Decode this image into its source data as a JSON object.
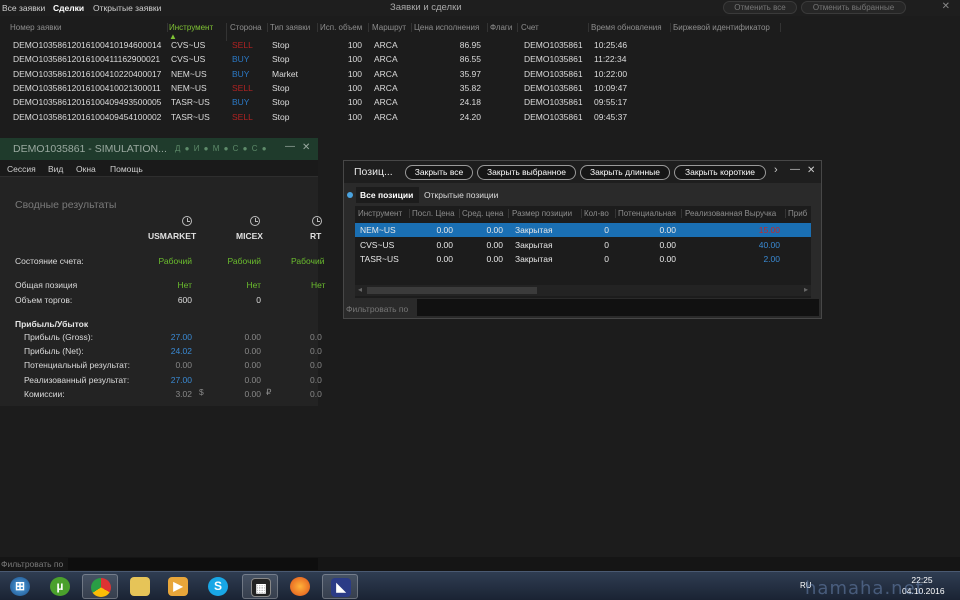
{
  "orders_window": {
    "tabs": [
      "Все заявки",
      "Сделки",
      "Открытые заявки"
    ],
    "active_tab": "Сделки",
    "title": "Заявки и сделки",
    "cancel_all": "Отменить все",
    "cancel_selected": "Отменить выбранные",
    "columns": [
      "Номер заявки",
      "Инструмент ▲",
      "Сторона",
      "Тип заявки",
      "Исп. объем",
      "Маршрут",
      "Цена исполнения",
      "Флаги",
      "Счет",
      "Время обновления",
      "Биржевой идентификатор"
    ],
    "rows": [
      {
        "id": "DEMO10358612016100410194600014",
        "instrument": "CVS~US",
        "side": "SELL",
        "type": "Stop",
        "qty": "100",
        "route": "ARCA",
        "price": "86.95",
        "account": "DEMO1035861",
        "time": "10:25:46"
      },
      {
        "id": "DEMO10358612016100411162900021",
        "instrument": "CVS~US",
        "side": "BUY",
        "type": "Stop",
        "qty": "100",
        "route": "ARCA",
        "price": "86.55",
        "account": "DEMO1035861",
        "time": "11:22:34"
      },
      {
        "id": "DEMO10358612016100410220400017",
        "instrument": "NEM~US",
        "side": "BUY",
        "type": "Market",
        "qty": "100",
        "route": "ARCA",
        "price": "35.97",
        "account": "DEMO1035861",
        "time": "10:22:00"
      },
      {
        "id": "DEMO10358612016100410021300011",
        "instrument": "NEM~US",
        "side": "SELL",
        "type": "Stop",
        "qty": "100",
        "route": "ARCA",
        "price": "35.82",
        "account": "DEMO1035861",
        "time": "10:09:47"
      },
      {
        "id": "DEMO10358612016100409493500005",
        "instrument": "TASR~US",
        "side": "BUY",
        "type": "Stop",
        "qty": "100",
        "route": "ARCA",
        "price": "24.18",
        "account": "DEMO1035861",
        "time": "09:55:17"
      },
      {
        "id": "DEMO10358612016100409454100002",
        "instrument": "TASR~US",
        "side": "SELL",
        "type": "Stop",
        "qty": "100",
        "route": "ARCA",
        "price": "24.20",
        "account": "DEMO1035861",
        "time": "09:45:37"
      }
    ]
  },
  "dashboard": {
    "title": "DEMO1035861 - SIMULATION...",
    "title_dots": "Д ● И ● М ● С ● С ●",
    "menu": [
      "Сессия",
      "Вид",
      "Окна",
      "Помощь"
    ],
    "section": "Сводные результаты",
    "markets": [
      "USMARKET",
      "MICEX",
      "RT"
    ],
    "labels": {
      "state": "Состояние счета:",
      "position": "Общая позиция",
      "volume": "Объем торгов:",
      "pnl": "Прибыль/Убыток",
      "gross": "Прибыль (Gross):",
      "net": "Прибыль (Net):",
      "potential": "Потенциальный результат:",
      "realized": "Реализованный результат:",
      "commission": "Комиссии:"
    },
    "values": {
      "state": [
        "Рабочий",
        "Рабочий",
        "Рабочий"
      ],
      "position": [
        "Нет",
        "Нет",
        "Нет"
      ],
      "volume": [
        "600",
        "0"
      ],
      "gross": [
        "27.00",
        "0.00",
        "0.0"
      ],
      "net": [
        "24.02",
        "0.00",
        "0.0"
      ],
      "potential": [
        "0.00",
        "0.00",
        "0.0"
      ],
      "realized": [
        "27.00",
        "0.00",
        "0.0"
      ],
      "commission": [
        "3.02",
        "0.00",
        "0.0"
      ]
    },
    "currency": [
      "$",
      "₽"
    ]
  },
  "positions": {
    "title": "Позиц...",
    "buttons": [
      "Закрыть все",
      "Закрыть выбранное",
      "Закрыть длинные",
      "Закрыть короткие"
    ],
    "tabs": [
      "Все позиции",
      "Открытые позиции"
    ],
    "columns": [
      "Инструмент",
      "Посл. Цена",
      "Сред. цена",
      "Размер позиции",
      "Кол-во",
      "Потенциальная",
      "Реализованная Выручка",
      "Приб"
    ],
    "rows": [
      {
        "instrument": "NEM~US",
        "last": "0.00",
        "avg": "0.00",
        "size": "Закрытая",
        "qty": "0",
        "potential": "0.00",
        "realized": "15.00"
      },
      {
        "instrument": "CVS~US",
        "last": "0.00",
        "avg": "0.00",
        "size": "Закрытая",
        "qty": "0",
        "potential": "0.00",
        "realized": "40.00"
      },
      {
        "instrument": "TASR~US",
        "last": "0.00",
        "avg": "0.00",
        "size": "Закрытая",
        "qty": "0",
        "potential": "0.00",
        "realized": "2.00"
      }
    ],
    "filter_label": "Фильтровать по"
  },
  "bottom_filter": "Фильтровать по",
  "taskbar": {
    "lang": "RU",
    "time": "22:25",
    "date": "04.10.2016",
    "apps": [
      "start",
      "utorrent",
      "chrome",
      "explorer",
      "media-player",
      "skype",
      "video-editor",
      "firefox",
      "app"
    ]
  },
  "watermark": "hamaha.net",
  "colors": {
    "buy": "#2b79c5",
    "sell": "#b02222",
    "green": "#6bbd2e",
    "selection": "#1a6fb3"
  }
}
